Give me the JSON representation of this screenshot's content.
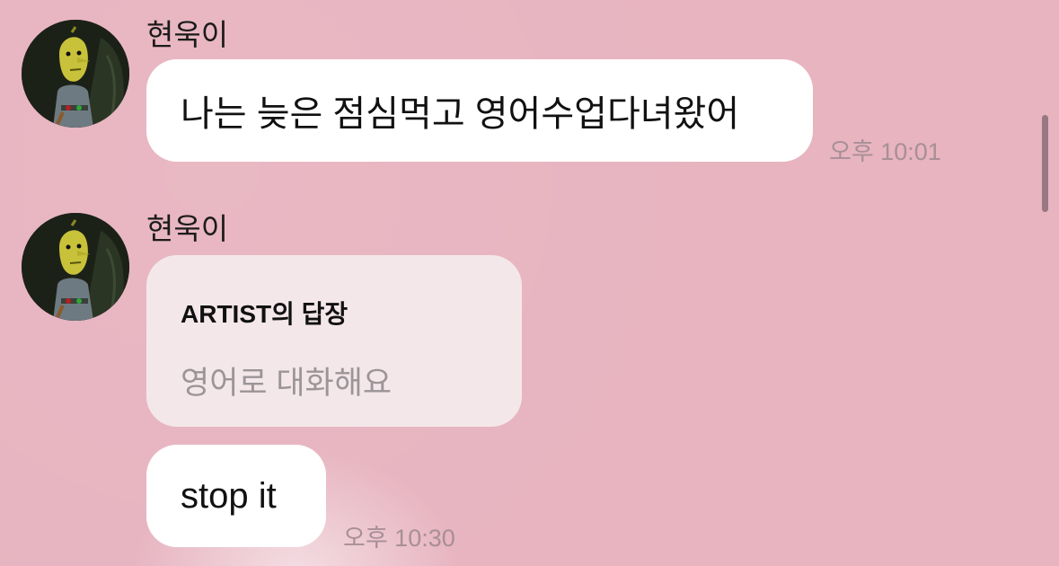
{
  "colors": {
    "background": "#e7b4c0",
    "bubble": "#ffffff",
    "reply_card": "#f4e7ea",
    "timestamp": "#a88f97"
  },
  "messages": [
    {
      "sender": "현욱이",
      "avatar_icon": "lemongrab-avatar-icon",
      "text": "나는 늦은 점심먹고 영어수업다녀왔어",
      "time": "오후 10:01"
    },
    {
      "sender": "현욱이",
      "avatar_icon": "lemongrab-avatar-icon",
      "reply": {
        "title": "ARTIST의 답장",
        "quote": "영어로 대화해요"
      },
      "text": "stop it",
      "time": "오후 10:30"
    }
  ]
}
